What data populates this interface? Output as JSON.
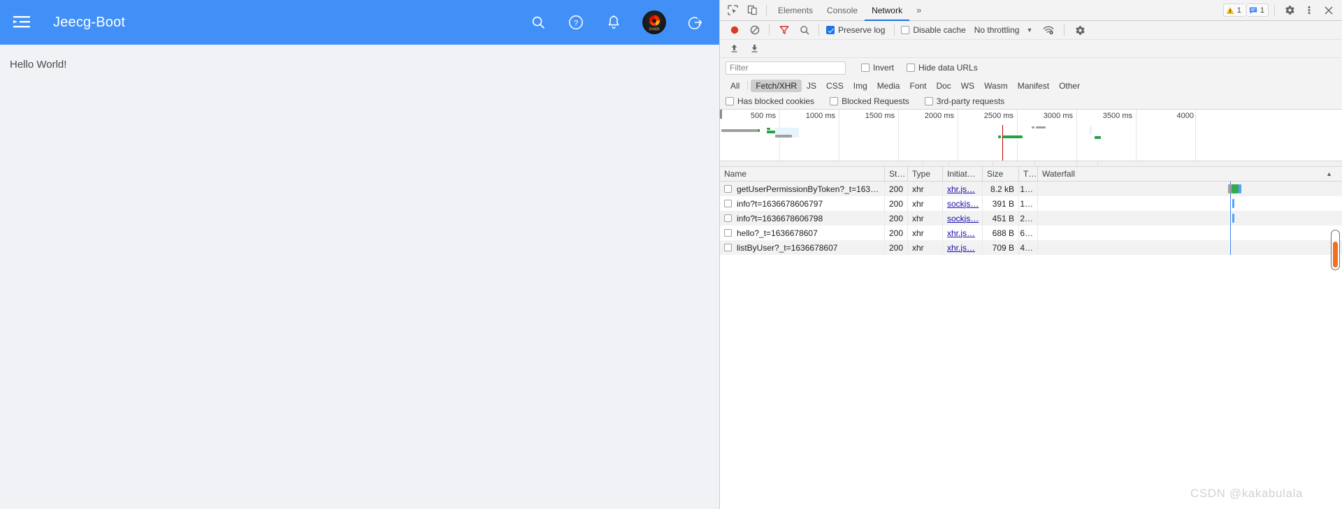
{
  "app": {
    "title": "Jeecg-Boot",
    "menu_icon": "menu-fold-icon",
    "header_icons": [
      "search-icon",
      "help-circle-icon",
      "bell-icon",
      "user-avatar",
      "logout-icon"
    ],
    "avatar_caption": "积木报表",
    "body_text": "Hello World!",
    "brand_color": "#4190f7"
  },
  "devtools": {
    "tabs": [
      {
        "label": "Elements",
        "active": false
      },
      {
        "label": "Console",
        "active": false
      },
      {
        "label": "Network",
        "active": true
      }
    ],
    "more_tabs_glyph": "»",
    "inspect_icon": "inspect-element-icon",
    "device_icon": "device-toolbar-icon",
    "warning_count": "1",
    "message_count": "1",
    "settings_icon": "gear-icon",
    "kebab_icon": "more-vertical-icon",
    "close_icon": "close-icon",
    "toolbar": {
      "record_label": "Record",
      "clear_label": "Clear",
      "filter_label": "Filter",
      "search_label": "Search",
      "preserve_log": "Preserve log",
      "preserve_log_checked": true,
      "disable_cache": "Disable cache",
      "disable_cache_checked": false,
      "throttling": "No throttling",
      "caret": "▼",
      "network_conditions_icon": "wifi-settings-icon",
      "capture_settings_icon": "gear-icon",
      "import_har_icon": "import-har-icon",
      "export_har_icon": "export-har-icon"
    },
    "filter": {
      "placeholder": "Filter",
      "value": "",
      "invert": "Invert",
      "invert_checked": false,
      "hide_data_urls": "Hide data URLs",
      "hide_data_urls_checked": false
    },
    "resource_types": [
      {
        "label": "All",
        "active": false
      },
      {
        "label": "Fetch/XHR",
        "active": true
      },
      {
        "label": "JS",
        "active": false
      },
      {
        "label": "CSS",
        "active": false
      },
      {
        "label": "Img",
        "active": false
      },
      {
        "label": "Media",
        "active": false
      },
      {
        "label": "Font",
        "active": false
      },
      {
        "label": "Doc",
        "active": false
      },
      {
        "label": "WS",
        "active": false
      },
      {
        "label": "Wasm",
        "active": false
      },
      {
        "label": "Manifest",
        "active": false
      },
      {
        "label": "Other",
        "active": false
      }
    ],
    "extra_filters": [
      {
        "label": "Has blocked cookies",
        "checked": false
      },
      {
        "label": "Blocked Requests",
        "checked": false
      },
      {
        "label": "3rd-party requests",
        "checked": false
      }
    ],
    "overview": {
      "ticks": [
        "500 ms",
        "1000 ms",
        "1500 ms",
        "2000 ms",
        "2500 ms",
        "3000 ms",
        "3500 ms",
        "4000"
      ],
      "red_marker_ms": 2500
    },
    "table": {
      "columns": [
        "Name",
        "St…",
        "Type",
        "Initiat…",
        "Size",
        "T…",
        "Waterfall"
      ],
      "sort_glyph": "▲",
      "rows": [
        {
          "name": "getUserPermissionByToken?_t=1636…",
          "status": "200",
          "type": "xhr",
          "initiator": "xhr.js…",
          "size": "8.2 kB",
          "time": "1…"
        },
        {
          "name": "info?t=1636678606797",
          "status": "200",
          "type": "xhr",
          "initiator": "sockjs…",
          "size": "391 B",
          "time": "1…"
        },
        {
          "name": "info?t=1636678606798",
          "status": "200",
          "type": "xhr",
          "initiator": "sockjs…",
          "size": "451 B",
          "time": "2…"
        },
        {
          "name": "hello?_t=1636678607",
          "status": "200",
          "type": "xhr",
          "initiator": "xhr.js…",
          "size": "688 B",
          "time": "6…"
        },
        {
          "name": "listByUser?_t=1636678607",
          "status": "200",
          "type": "xhr",
          "initiator": "xhr.js…",
          "size": "709 B",
          "time": "4…"
        }
      ]
    }
  },
  "watermark": "CSDN @kakabulala"
}
